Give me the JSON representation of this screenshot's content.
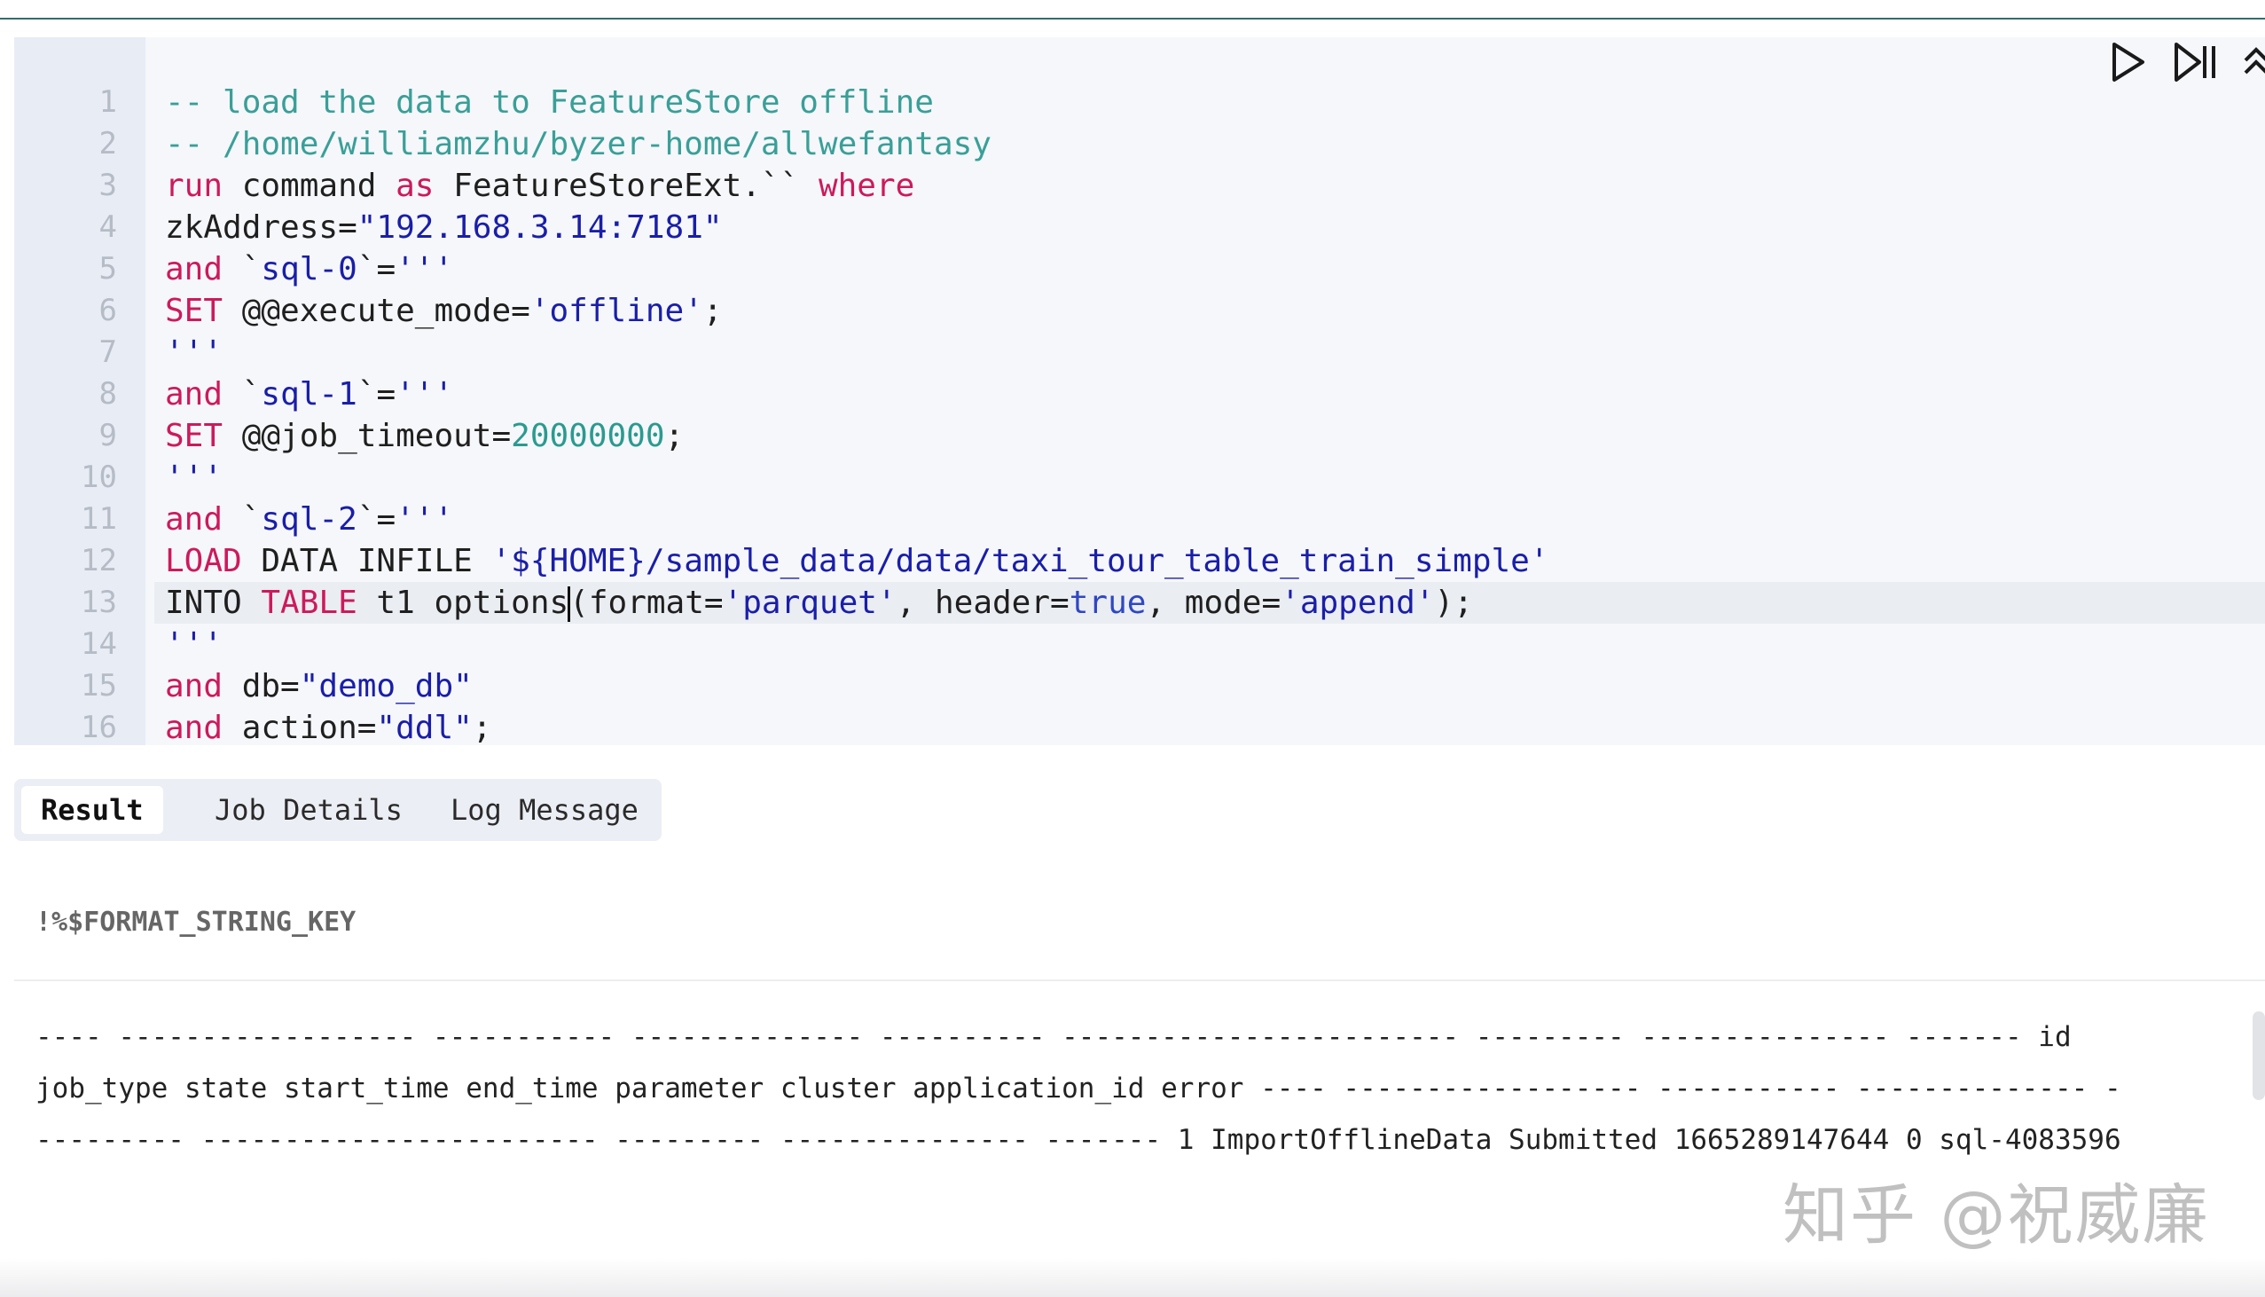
{
  "editor": {
    "line_numbers": [
      "1",
      "2",
      "3",
      "4",
      "5",
      "6",
      "7",
      "8",
      "9",
      "10",
      "11",
      "12",
      "13",
      "14",
      "15",
      "16"
    ],
    "lines": [
      [
        {
          "t": "c",
          "v": "-- load the data to FeatureStore offline"
        }
      ],
      [
        {
          "t": "c",
          "v": "-- /home/williamzhu/byzer-home/allwefantasy"
        }
      ],
      [
        {
          "t": "k",
          "v": "run"
        },
        {
          "t": "p",
          "v": " command "
        },
        {
          "t": "k",
          "v": "as"
        },
        {
          "t": "p",
          "v": " FeatureStoreExt.`` "
        },
        {
          "t": "k",
          "v": "where"
        }
      ],
      [
        {
          "t": "p",
          "v": "zkAddress="
        },
        {
          "t": "s",
          "v": "\"192.168.3.14:7181\""
        }
      ],
      [
        {
          "t": "k",
          "v": "and"
        },
        {
          "t": "p",
          "v": " `"
        },
        {
          "t": "s",
          "v": "sql-0"
        },
        {
          "t": "p",
          "v": "`="
        },
        {
          "t": "s",
          "v": "'''"
        }
      ],
      [
        {
          "t": "k",
          "v": "SET"
        },
        {
          "t": "p",
          "v": " @@execute_mode="
        },
        {
          "t": "s",
          "v": "'offline'"
        },
        {
          "t": "p",
          "v": ";"
        }
      ],
      [
        {
          "t": "s",
          "v": "'''"
        }
      ],
      [
        {
          "t": "k",
          "v": "and"
        },
        {
          "t": "p",
          "v": " `"
        },
        {
          "t": "s",
          "v": "sql-1"
        },
        {
          "t": "p",
          "v": "`="
        },
        {
          "t": "s",
          "v": "'''"
        }
      ],
      [
        {
          "t": "k",
          "v": "SET"
        },
        {
          "t": "p",
          "v": " @@job_timeout="
        },
        {
          "t": "n",
          "v": "20000000"
        },
        {
          "t": "p",
          "v": ";"
        }
      ],
      [
        {
          "t": "s",
          "v": "'''"
        }
      ],
      [
        {
          "t": "k",
          "v": "and"
        },
        {
          "t": "p",
          "v": " `"
        },
        {
          "t": "s",
          "v": "sql-2"
        },
        {
          "t": "p",
          "v": "`="
        },
        {
          "t": "s",
          "v": "'''"
        }
      ],
      [
        {
          "t": "k",
          "v": "LOAD"
        },
        {
          "t": "p",
          "v": " DATA INFILE "
        },
        {
          "t": "s",
          "v": "'${HOME}/sample_data/data/taxi_tour_table_train_simple'"
        }
      ],
      [
        {
          "t": "p",
          "v": "INTO "
        },
        {
          "t": "k",
          "v": "TABLE"
        },
        {
          "t": "p",
          "v": " t1 options"
        },
        {
          "t": "caret",
          "v": ""
        },
        {
          "t": "p",
          "v": "(format="
        },
        {
          "t": "s",
          "v": "'parquet'"
        },
        {
          "t": "p",
          "v": ", header="
        },
        {
          "t": "b",
          "v": "true"
        },
        {
          "t": "p",
          "v": ", mode="
        },
        {
          "t": "s",
          "v": "'append'"
        },
        {
          "t": "p",
          "v": ");"
        }
      ],
      [
        {
          "t": "s",
          "v": "'''"
        }
      ],
      [
        {
          "t": "k",
          "v": "and"
        },
        {
          "t": "p",
          "v": " db="
        },
        {
          "t": "s",
          "v": "\"demo_db\""
        }
      ],
      [
        {
          "t": "k",
          "v": "and"
        },
        {
          "t": "p",
          "v": " action="
        },
        {
          "t": "s",
          "v": "\"ddl\""
        },
        {
          "t": "p",
          "v": ";"
        }
      ]
    ],
    "active_line": 13
  },
  "controls": {
    "run_icon": "play-icon",
    "step_icon": "play-pause-icon",
    "collapse_icon": "collapse-icon"
  },
  "tabs": {
    "result": "Result",
    "job_details": "Job Details",
    "log_message": "Log Message"
  },
  "result": {
    "format_key": "!%$FORMAT_STRING_KEY",
    "output_lines": [
      "---- ------------------ ----------- -------------- ---------- ------------------------ --------- --------------- ------- id",
      "job_type state start_time end_time parameter cluster application_id error ---- ------------------ ----------- -------------- -",
      "--------- ------------------------ --------- --------------- ------- 1 ImportOfflineData Submitted 1665289147644 0 sql-4083596"
    ]
  },
  "watermark": "知乎 @祝威廉",
  "colors": {
    "comment": "#3a9f98",
    "keyword": "#cc1a5c",
    "string": "#1a1ea8",
    "number": "#2b9a8f",
    "boolean": "#2f47c2"
  }
}
